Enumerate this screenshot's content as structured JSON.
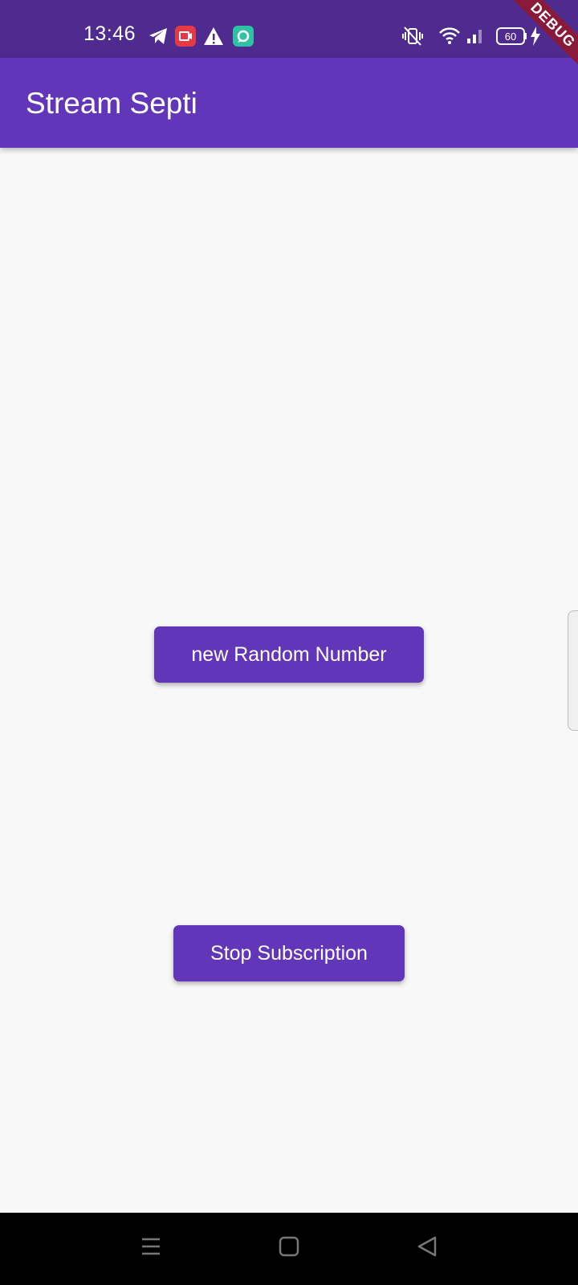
{
  "status_bar": {
    "time": "13:46",
    "battery_level": "60",
    "icons": [
      "telegram-icon",
      "screen-record-icon",
      "warning-icon",
      "app-notification-icon",
      "vibrate-icon",
      "wifi-icon",
      "signal-icon",
      "battery-icon",
      "charging-icon"
    ]
  },
  "debug_banner": "DEBUG",
  "app_bar": {
    "title": "Stream Septi",
    "color": "#6236b8"
  },
  "main": {
    "random_button_label": "new Random Number",
    "stop_button_label": "Stop Subscription"
  },
  "nav_bar": {
    "icons": [
      "menu-icon",
      "home-icon",
      "back-icon"
    ]
  }
}
